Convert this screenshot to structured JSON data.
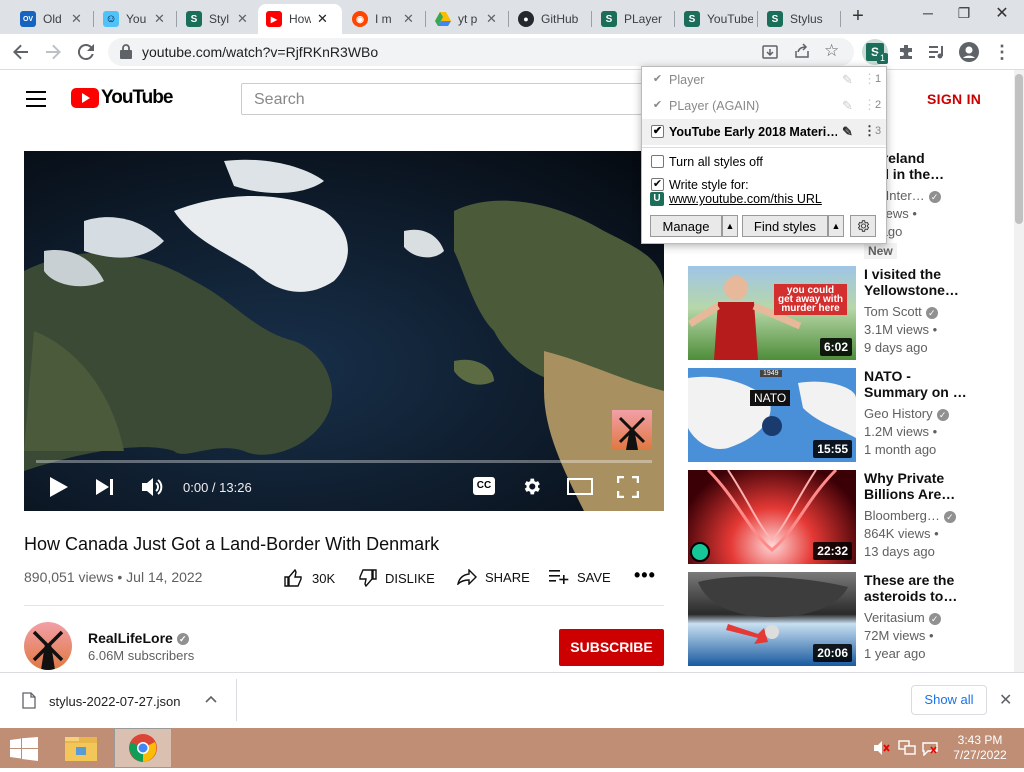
{
  "browser": {
    "tabs": [
      {
        "label": "Old",
        "favicon": "ov-icon",
        "color": "#1565c0",
        "glyph": "OV"
      },
      {
        "label": "You",
        "favicon": "alien-icon",
        "color": "#4fc3f7",
        "glyph": "☺"
      },
      {
        "label": "Styl",
        "favicon": "stylus-icon",
        "color": "#1b6e5a",
        "glyph": "S"
      },
      {
        "label": "How",
        "favicon": "youtube-icon",
        "color": "#ff0000",
        "glyph": "▶",
        "active": true
      },
      {
        "label": "I m",
        "favicon": "reddit-icon",
        "color": "#ff4500",
        "glyph": "●"
      },
      {
        "label": "yt p",
        "favicon": "drive-icon",
        "color": "#34a853",
        "glyph": "▲"
      },
      {
        "label": "GitHub",
        "favicon": "github-icon",
        "color": "#24292f",
        "glyph": "●"
      },
      {
        "label": "PLayer",
        "favicon": "stylus-icon",
        "color": "#1b6e5a",
        "glyph": "S"
      },
      {
        "label": "YouTube",
        "favicon": "stylus-icon",
        "color": "#1b6e5a",
        "glyph": "S"
      },
      {
        "label": "Stylus",
        "favicon": "stylus-icon",
        "color": "#1b6e5a",
        "glyph": "S"
      }
    ],
    "new_tab": "+",
    "url": "youtube.com/watch?v=RjfRKnR3WBo",
    "extension_badge": "1"
  },
  "youtube": {
    "logo_text": "YouTube",
    "search_placeholder": "Search",
    "sign_in": "SIGN IN",
    "video": {
      "time": "0:00 / 13:26",
      "progress": 0.0,
      "title": "How Canada Just Got a Land-Border With Denmark",
      "meta": "890,051 views • Jul 14, 2022",
      "likes": "30K",
      "dislike": "DISLIKE",
      "share": "SHARE",
      "save": "SAVE",
      "cc": "CC"
    },
    "channel": {
      "name": "RealLifeLore",
      "subscribers": "6.06M subscribers",
      "subscribe": "SUBSCRIBE"
    },
    "recommendations": [
      {
        "title_1": "w Ireland",
        "title_2": "ded in the…",
        "channel": "BC Inter…",
        "views": "K views •",
        "age": "ys ago",
        "badge": "New"
      },
      {
        "title_1": "I visited the",
        "title_2": "Yellowstone…",
        "channel": "Tom Scott",
        "views": "3.1M views •",
        "age": "9 days ago",
        "duration": "6:02",
        "thumb_text_1": "you could",
        "thumb_text_2": "get away with",
        "thumb_text_3": "murder here"
      },
      {
        "title_1": "NATO -",
        "title_2": "Summary on …",
        "channel": "Geo History",
        "views": "1.2M views •",
        "age": "1 month ago",
        "duration": "15:55",
        "thumb_text_1": "NATO",
        "thumb_text_2": "1949"
      },
      {
        "title_1": "Why Private",
        "title_2": "Billions Are…",
        "channel": "Bloomberg…",
        "views": "864K views •",
        "age": "13 days ago",
        "duration": "22:32"
      },
      {
        "title_1": "These are the",
        "title_2": "asteroids to…",
        "channel": "Veritasium",
        "views": "72M views •",
        "age": "1 year ago",
        "duration": "20:06"
      }
    ]
  },
  "stylus": {
    "styles": [
      {
        "name": "Player",
        "enabled": true,
        "number": "1"
      },
      {
        "name": "PLayer (AGAIN)",
        "enabled": true,
        "number": "2"
      },
      {
        "name": "YouTube Early 2018 Materi…",
        "enabled": true,
        "number": "3",
        "active": true
      }
    ],
    "turn_all_off": "Turn all styles off",
    "write_style_for": "Write style for:",
    "write_style_url": "www.youtube.com/this URL",
    "manage": "Manage",
    "find_styles": "Find styles"
  },
  "download": {
    "filename": "stylus-2022-07-27.json",
    "show_all": "Show all"
  },
  "taskbar": {
    "time": "3:43 PM",
    "date": "7/27/2022"
  }
}
